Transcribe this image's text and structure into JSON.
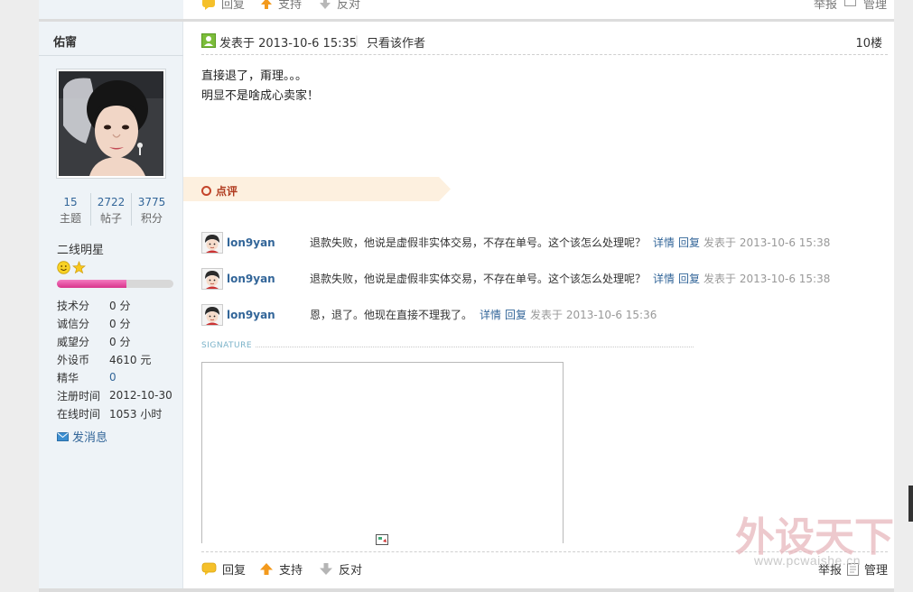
{
  "top_actions": {
    "reply": "回复",
    "support": "支持",
    "oppose": "反对",
    "report": "举报",
    "manage": "管理"
  },
  "user": {
    "name": "佑甯",
    "stats": [
      {
        "value": "15",
        "label": "主题"
      },
      {
        "value": "2722",
        "label": "帖子"
      },
      {
        "value": "3775",
        "label": "积分"
      }
    ],
    "rank": "二线明星",
    "rank_progress_percent": 60,
    "profile": [
      {
        "key": "技术分",
        "value": "0 分"
      },
      {
        "key": "诚信分",
        "value": "0 分"
      },
      {
        "key": "威望分",
        "value": "0 分"
      },
      {
        "key": "外设币",
        "value": "4610 元"
      },
      {
        "key": "精华",
        "value": "0"
      },
      {
        "key": "注册时间",
        "value": "2012-10-30"
      },
      {
        "key": "在线时间",
        "value": "1053 小时"
      }
    ],
    "send_message": "发消息"
  },
  "post": {
    "posted_at": "发表于 2013-10-6 15:35",
    "only_author": "只看该作者",
    "floor": "10楼",
    "content_lines": [
      "直接退了，甭理。。。",
      "明显不是啥成心卖家！"
    ],
    "rate_label": "点评",
    "comments": [
      {
        "author": "lon9yan",
        "text": "退款失败，他说是虚假非实体交易，不存在单号。这个该怎么处理呢？",
        "detail": "详情",
        "reply": "回复",
        "time": "发表于 2013-10-6 15:38"
      },
      {
        "author": "lon9yan",
        "text": "退款失败，他说是虚假非实体交易，不存在单号。这个该怎么处理呢？",
        "detail": "详情",
        "reply": "回复",
        "time": "发表于 2013-10-6 15:38"
      },
      {
        "author": "lon9yan",
        "text": "恩，退了。他现在直接不理我了。",
        "detail": "详情",
        "reply": "回复",
        "time": "发表于 2013-10-6 15:36"
      }
    ],
    "signature_label": "SIGNATURE"
  },
  "bottom_actions": {
    "reply": "回复",
    "support": "支持",
    "oppose": "反对",
    "report": "举报",
    "manage": "管理"
  },
  "watermark": {
    "logo_text": "外设天下",
    "url": "www.pcwaishe.cn"
  },
  "colors": {
    "link": "#336699",
    "panel_bg": "#eef3f7",
    "rate_tag_bg": "#fdf0df",
    "rank_bar": "#e0479a"
  }
}
